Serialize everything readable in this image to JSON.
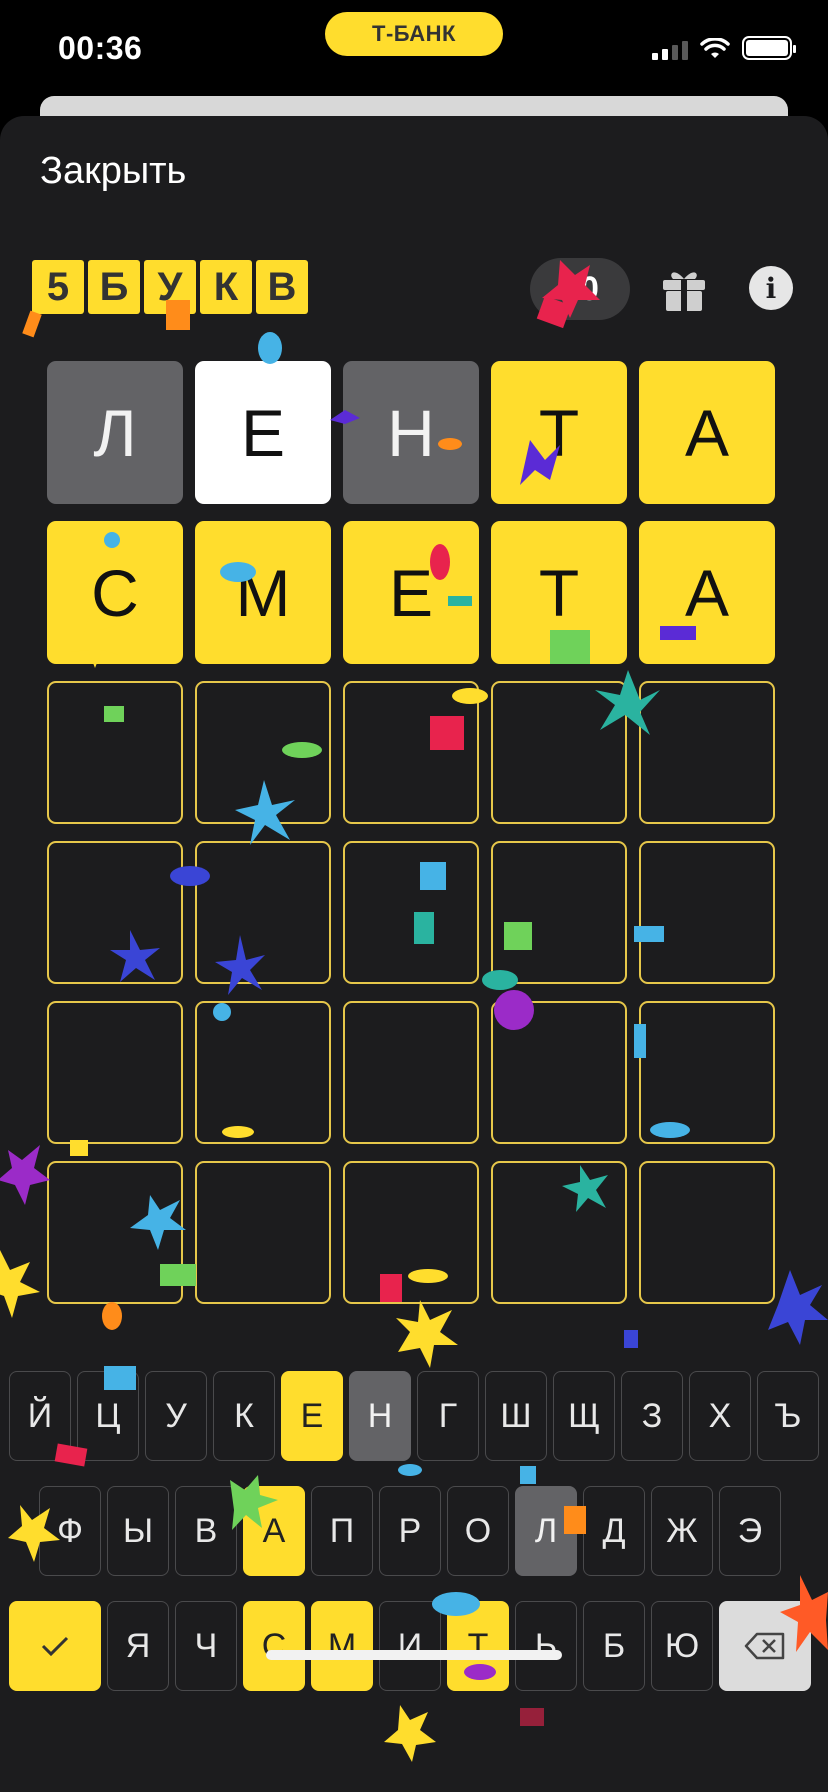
{
  "status_bar": {
    "time": "00:36",
    "brand": "Т-БАНК"
  },
  "header": {
    "close_label": "Закрыть"
  },
  "logo": {
    "letters": [
      "5",
      "Б",
      "У",
      "К",
      "В"
    ]
  },
  "score": {
    "value": "10"
  },
  "icons": {
    "gift": "gift-icon",
    "info": "info-icon",
    "check": "check-icon",
    "backspace": "backspace-icon"
  },
  "colors": {
    "accent": "#ffdd2d",
    "absent": "#636366",
    "present": "#ffffff",
    "sheet": "#1c1c1e",
    "empty_border": "#e6c74a"
  },
  "board": {
    "rows": [
      [
        {
          "letter": "Л",
          "state": "absent"
        },
        {
          "letter": "Е",
          "state": "present"
        },
        {
          "letter": "Н",
          "state": "absent"
        },
        {
          "letter": "Т",
          "state": "correct"
        },
        {
          "letter": "А",
          "state": "correct"
        }
      ],
      [
        {
          "letter": "С",
          "state": "correct"
        },
        {
          "letter": "М",
          "state": "correct"
        },
        {
          "letter": "Е",
          "state": "correct"
        },
        {
          "letter": "Т",
          "state": "correct"
        },
        {
          "letter": "А",
          "state": "correct"
        }
      ],
      [
        {
          "letter": "",
          "state": "empty"
        },
        {
          "letter": "",
          "state": "empty"
        },
        {
          "letter": "",
          "state": "empty"
        },
        {
          "letter": "",
          "state": "empty"
        },
        {
          "letter": "",
          "state": "empty"
        }
      ],
      [
        {
          "letter": "",
          "state": "empty"
        },
        {
          "letter": "",
          "state": "empty"
        },
        {
          "letter": "",
          "state": "empty"
        },
        {
          "letter": "",
          "state": "empty"
        },
        {
          "letter": "",
          "state": "empty"
        }
      ],
      [
        {
          "letter": "",
          "state": "empty"
        },
        {
          "letter": "",
          "state": "empty"
        },
        {
          "letter": "",
          "state": "empty"
        },
        {
          "letter": "",
          "state": "empty"
        },
        {
          "letter": "",
          "state": "empty"
        }
      ],
      [
        {
          "letter": "",
          "state": "empty"
        },
        {
          "letter": "",
          "state": "empty"
        },
        {
          "letter": "",
          "state": "empty"
        },
        {
          "letter": "",
          "state": "empty"
        },
        {
          "letter": "",
          "state": "empty"
        }
      ]
    ]
  },
  "keyboard": {
    "row1": [
      {
        "k": "Й",
        "s": ""
      },
      {
        "k": "Ц",
        "s": ""
      },
      {
        "k": "У",
        "s": ""
      },
      {
        "k": "К",
        "s": ""
      },
      {
        "k": "Е",
        "s": "correct"
      },
      {
        "k": "Н",
        "s": "absent"
      },
      {
        "k": "Г",
        "s": ""
      },
      {
        "k": "Ш",
        "s": ""
      },
      {
        "k": "Щ",
        "s": ""
      },
      {
        "k": "З",
        "s": ""
      },
      {
        "k": "Х",
        "s": ""
      },
      {
        "k": "Ъ",
        "s": ""
      }
    ],
    "row2": [
      {
        "k": "Ф",
        "s": ""
      },
      {
        "k": "Ы",
        "s": ""
      },
      {
        "k": "В",
        "s": ""
      },
      {
        "k": "А",
        "s": "correct"
      },
      {
        "k": "П",
        "s": ""
      },
      {
        "k": "Р",
        "s": ""
      },
      {
        "k": "О",
        "s": ""
      },
      {
        "k": "Л",
        "s": "absent"
      },
      {
        "k": "Д",
        "s": ""
      },
      {
        "k": "Ж",
        "s": ""
      },
      {
        "k": "Э",
        "s": ""
      }
    ],
    "row3": [
      {
        "k": "Я",
        "s": ""
      },
      {
        "k": "Ч",
        "s": ""
      },
      {
        "k": "С",
        "s": "correct"
      },
      {
        "k": "М",
        "s": "correct"
      },
      {
        "k": "И",
        "s": ""
      },
      {
        "k": "Т",
        "s": "correct"
      },
      {
        "k": "Ь",
        "s": ""
      },
      {
        "k": "Б",
        "s": ""
      },
      {
        "k": "Ю",
        "s": ""
      }
    ]
  }
}
